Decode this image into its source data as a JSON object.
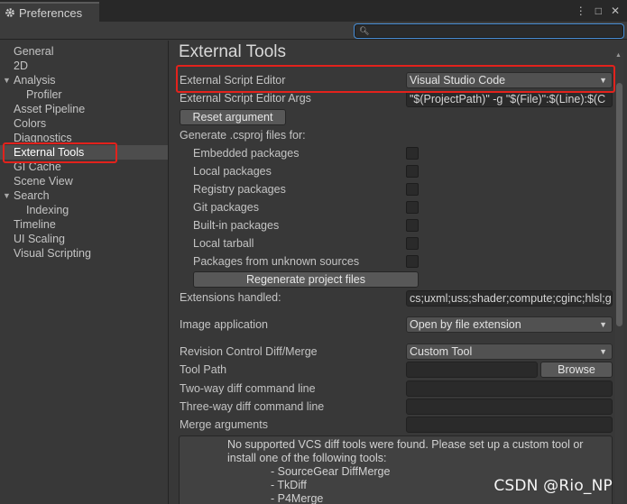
{
  "window": {
    "tab_title": "Preferences",
    "controls": [
      "⋮",
      "□",
      "✕"
    ]
  },
  "search": {
    "placeholder": "",
    "icon": "search-icon"
  },
  "sidebar": {
    "items": [
      {
        "label": "General",
        "selected": false,
        "indent": 0
      },
      {
        "label": "2D",
        "selected": false,
        "indent": 0
      },
      {
        "label": "Analysis",
        "selected": false,
        "indent": 0,
        "expander": "▼"
      },
      {
        "label": "Profiler",
        "selected": false,
        "indent": 1
      },
      {
        "label": "Asset Pipeline",
        "selected": false,
        "indent": 0
      },
      {
        "label": "Colors",
        "selected": false,
        "indent": 0
      },
      {
        "label": "Diagnostics",
        "selected": false,
        "indent": 0
      },
      {
        "label": "External Tools",
        "selected": true,
        "indent": 0
      },
      {
        "label": "GI Cache",
        "selected": false,
        "indent": 0
      },
      {
        "label": "Scene View",
        "selected": false,
        "indent": 0
      },
      {
        "label": "Search",
        "selected": false,
        "indent": 0,
        "expander": "▼"
      },
      {
        "label": "Indexing",
        "selected": false,
        "indent": 1
      },
      {
        "label": "Timeline",
        "selected": false,
        "indent": 0
      },
      {
        "label": "UI Scaling",
        "selected": false,
        "indent": 0
      },
      {
        "label": "Visual Scripting",
        "selected": false,
        "indent": 0
      }
    ]
  },
  "main": {
    "title": "External Tools",
    "script_editor_label": "External Script Editor",
    "script_editor_value": "Visual Studio Code",
    "script_args_label": "External Script Editor Args",
    "script_args_value": "\"$(ProjectPath)\" -g \"$(File)\":$(Line):$(C",
    "reset_button": "Reset argument",
    "csproj_heading": "Generate .csproj files for:",
    "packages": [
      {
        "label": "Embedded packages",
        "checked": false
      },
      {
        "label": "Local packages",
        "checked": false
      },
      {
        "label": "Registry packages",
        "checked": false
      },
      {
        "label": "Git packages",
        "checked": false
      },
      {
        "label": "Built-in packages",
        "checked": false
      },
      {
        "label": "Local tarball",
        "checked": false
      },
      {
        "label": "Packages from unknown sources",
        "checked": false
      }
    ],
    "regenerate_button": "Regenerate project files",
    "extensions_label": "Extensions handled:",
    "extensions_value": "cs;uxml;uss;shader;compute;cginc;hlsl;g",
    "image_app_label": "Image application",
    "image_app_value": "Open by file extension",
    "revision_label": "Revision Control Diff/Merge",
    "revision_value": "Custom Tool",
    "tool_path_label": "Tool Path",
    "browse_button": "Browse",
    "two_way_label": "Two-way diff command line",
    "three_way_label": "Three-way diff command line",
    "merge_args_label": "Merge arguments",
    "help_text": "No supported VCS diff tools were found. Please set up a custom tool or install one of the following tools:",
    "help_tools": [
      "- SourceGear DiffMerge",
      "- TkDiff",
      "- P4Merge"
    ]
  },
  "watermark": "CSDN @Rio_NP",
  "colors": {
    "highlight": "#e3221c",
    "selection": "#4d4d4d",
    "focus": "#4a90d9"
  }
}
